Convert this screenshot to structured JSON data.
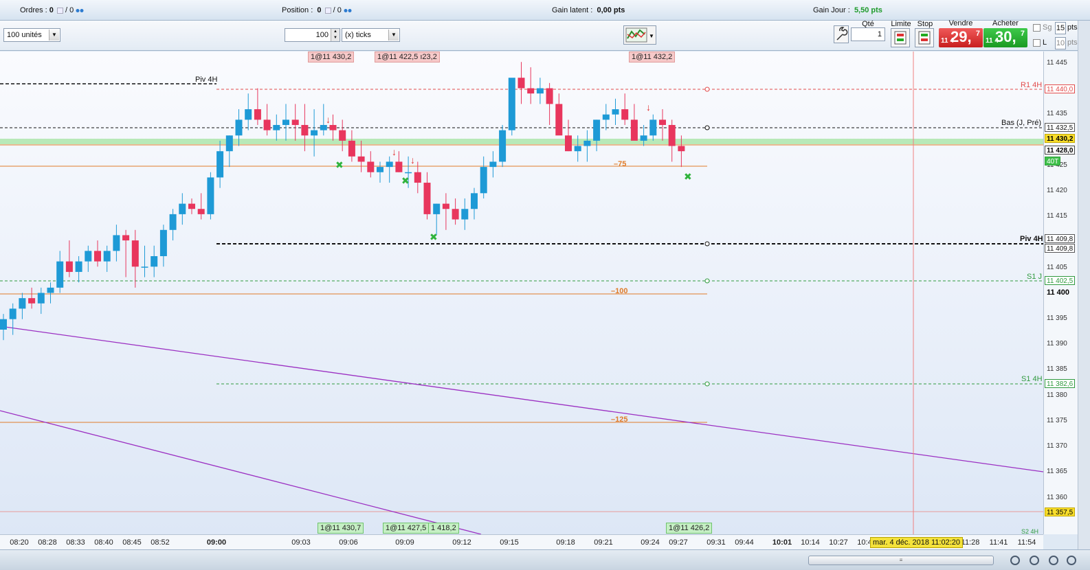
{
  "status": {
    "orders_label": "Ordres :",
    "orders_value": "0",
    "orders_value2": "/ 0",
    "position_label": "Position :",
    "position_value": "0",
    "position_value2": "/ 0",
    "latent_label": "Gain latent :",
    "latent_value": "0,00 pts",
    "day_label": "Gain Jour :",
    "day_value": "5,50 pts"
  },
  "toolbar": {
    "units": "100 unités",
    "ticks_value": "100",
    "ticks_unit": "(x) ticks",
    "qty_label": "Qté",
    "qty_value": "1",
    "limit_label": "Limite",
    "stop_label": "Stop",
    "sell_label": "Vendre",
    "sell_small": "11 4",
    "sell_big": "29,",
    "sell_sup": "7",
    "buy_label": "Acheter",
    "buy_small": "11 4",
    "buy_big": "30,",
    "buy_sup": "7",
    "sg_label": "Sg",
    "sg_value": "15",
    "sg_unit": "pts",
    "l_label": "L",
    "l_value": "10",
    "l_unit": "pts"
  },
  "colors": {
    "up": "#1e9ad6",
    "down": "#e8365d",
    "sell": "#d62a2a",
    "buy": "#26ad30"
  },
  "chart_labels": {
    "piv4h_left": "Piv 4H",
    "r1": "R1 4H",
    "bas": "Bas (J, Pré)",
    "piv4h_right": "Piv 4H",
    "s1j": "S1 J",
    "s14h": "S1 4H",
    "s24h": "S2 4H",
    "m75": "–75",
    "m100": "–100",
    "m125": "–125"
  },
  "order_tags": {
    "top": [
      "1@11 430,2",
      "1@11 422,5 ı‌23,2",
      "1@11 432,2"
    ],
    "bottom": [
      "1@11 430,7",
      "1@11 427,5",
      "1 418,2",
      "1@11 426,2"
    ]
  },
  "yaxis": {
    "ticks": [
      "11 445",
      "11 435",
      "11 425",
      "11 420",
      "11 415",
      "11 405",
      "11 400",
      "11 395",
      "11 390",
      "11 385",
      "11 380",
      "11 375",
      "11 370",
      "11 365",
      "11 360"
    ],
    "tags": {
      "r1": "11 440,0",
      "bas": "11 432,5",
      "cur": "11 430,2",
      "last": "11 428,0",
      "t40": "40T",
      "piv1": "11 409,8",
      "piv2": "11 409,8",
      "s1j": "11 402,5",
      "s14h": "11 382,6",
      "s2": "11 357,5"
    }
  },
  "xaxis": {
    "ticks": [
      "08:20",
      "08:28",
      "08:33",
      "08:40",
      "08:45",
      "08:52",
      "09:00",
      "09:03",
      "09:06",
      "09:09",
      "09:12",
      "09:15",
      "09:18",
      "09:21",
      "09:24",
      "09:27",
      "09:31",
      "09:44",
      "10:01",
      "10:14",
      "10:27",
      "10:4",
      "11:28",
      "11:41",
      "11:54"
    ],
    "crosshair_date": "mar. 4 déc. 2018 11:02:20"
  },
  "chart_data": {
    "type": "candlestick",
    "ylim": [
      11355,
      11447
    ],
    "candles": [
      [
        11394,
        11397,
        11392,
        11396
      ],
      [
        11396,
        11399,
        11393,
        11398
      ],
      [
        11398,
        11401,
        11396,
        11400
      ],
      [
        11400,
        11402,
        11398,
        11399
      ],
      [
        11399,
        11402,
        11397,
        11401
      ],
      [
        11401,
        11403,
        11399,
        11402
      ],
      [
        11402,
        11409,
        11401,
        11407
      ],
      [
        11407,
        11411,
        11404,
        11405
      ],
      [
        11405,
        11408,
        11403,
        11407
      ],
      [
        11407,
        11410,
        11405,
        11409
      ],
      [
        11409,
        11411,
        11406,
        11407
      ],
      [
        11407,
        11410,
        11405,
        11409
      ],
      [
        11409,
        11414,
        11407,
        11412
      ],
      [
        11412,
        11413,
        11404,
        11411
      ],
      [
        11411,
        11413,
        11402,
        11406
      ],
      [
        11406,
        11410,
        11404,
        11406
      ],
      [
        11406,
        11410,
        11404,
        11408
      ],
      [
        11408,
        11414,
        11406,
        11413
      ],
      [
        11413,
        11417,
        11411,
        11416
      ],
      [
        11416,
        11420,
        11414,
        11418
      ],
      [
        11418,
        11419,
        11416,
        11417
      ],
      [
        11417,
        11420,
        11415,
        11416
      ],
      [
        11416,
        11424,
        11415,
        11423
      ],
      [
        11423,
        11430,
        11421,
        11428
      ],
      [
        11428,
        11431,
        11425,
        11431
      ],
      [
        11431,
        11436,
        11429,
        11434
      ],
      [
        11434,
        11439,
        11432,
        11436
      ],
      [
        11436,
        11440,
        11433,
        11434
      ],
      [
        11434,
        11437,
        11431,
        11432
      ],
      [
        11432,
        11435,
        11430,
        11433
      ],
      [
        11433,
        11437,
        11430,
        11434
      ],
      [
        11434,
        11437,
        11430,
        11433
      ],
      [
        11433,
        11437,
        11428,
        11431
      ],
      [
        11431,
        11436,
        11427,
        11432
      ],
      [
        11432,
        11437,
        11431,
        11433
      ],
      [
        11433,
        11435,
        11430,
        11432
      ],
      [
        11432,
        11434,
        11428,
        11430
      ],
      [
        11430,
        11432,
        11426,
        11427
      ],
      [
        11427,
        11430,
        11424,
        11426
      ],
      [
        11426,
        11428,
        11423,
        11424
      ],
      [
        11424,
        11426,
        11422,
        11425
      ],
      [
        11425,
        11427,
        11422,
        11426
      ],
      [
        11426,
        11428,
        11424,
        11424
      ],
      [
        11424,
        11427,
        11421,
        11424
      ],
      [
        11424,
        11426,
        11420,
        11422
      ],
      [
        11422,
        11424,
        11415,
        11416
      ],
      [
        11416,
        11418,
        11412,
        11418
      ],
      [
        11418,
        11420,
        11413,
        11417
      ],
      [
        11417,
        11419,
        11414,
        11415
      ],
      [
        11415,
        11419,
        11413,
        11417
      ],
      [
        11417,
        11421,
        11415,
        11420
      ],
      [
        11420,
        11427,
        11419,
        11425
      ],
      [
        11425,
        11428,
        11423,
        11426
      ],
      [
        11426,
        11433,
        11425,
        11432
      ],
      [
        11432,
        11441,
        11431,
        11442
      ],
      [
        11442,
        11445,
        11437,
        11440
      ],
      [
        11440,
        11444,
        11437,
        11439
      ],
      [
        11439,
        11442,
        11437,
        11440
      ],
      [
        11440,
        11441,
        11433,
        11437
      ],
      [
        11437,
        11439,
        11432,
        11431
      ],
      [
        11431,
        11434,
        11428,
        11428
      ],
      [
        11428,
        11431,
        11426,
        11429
      ],
      [
        11429,
        11432,
        11426,
        11430
      ],
      [
        11430,
        11434,
        11428,
        11434
      ],
      [
        11434,
        11437,
        11432,
        11435
      ],
      [
        11435,
        11438,
        11433,
        11436
      ],
      [
        11436,
        11439,
        11433,
        11434
      ],
      [
        11434,
        11437,
        11431,
        11430
      ],
      [
        11430,
        11433,
        11429,
        11431
      ],
      [
        11431,
        11435,
        11430,
        11434
      ],
      [
        11434,
        11436,
        11430,
        11433
      ],
      [
        11433,
        11434,
        11426,
        11429
      ],
      [
        11429,
        11431,
        11425,
        11428
      ]
    ]
  }
}
